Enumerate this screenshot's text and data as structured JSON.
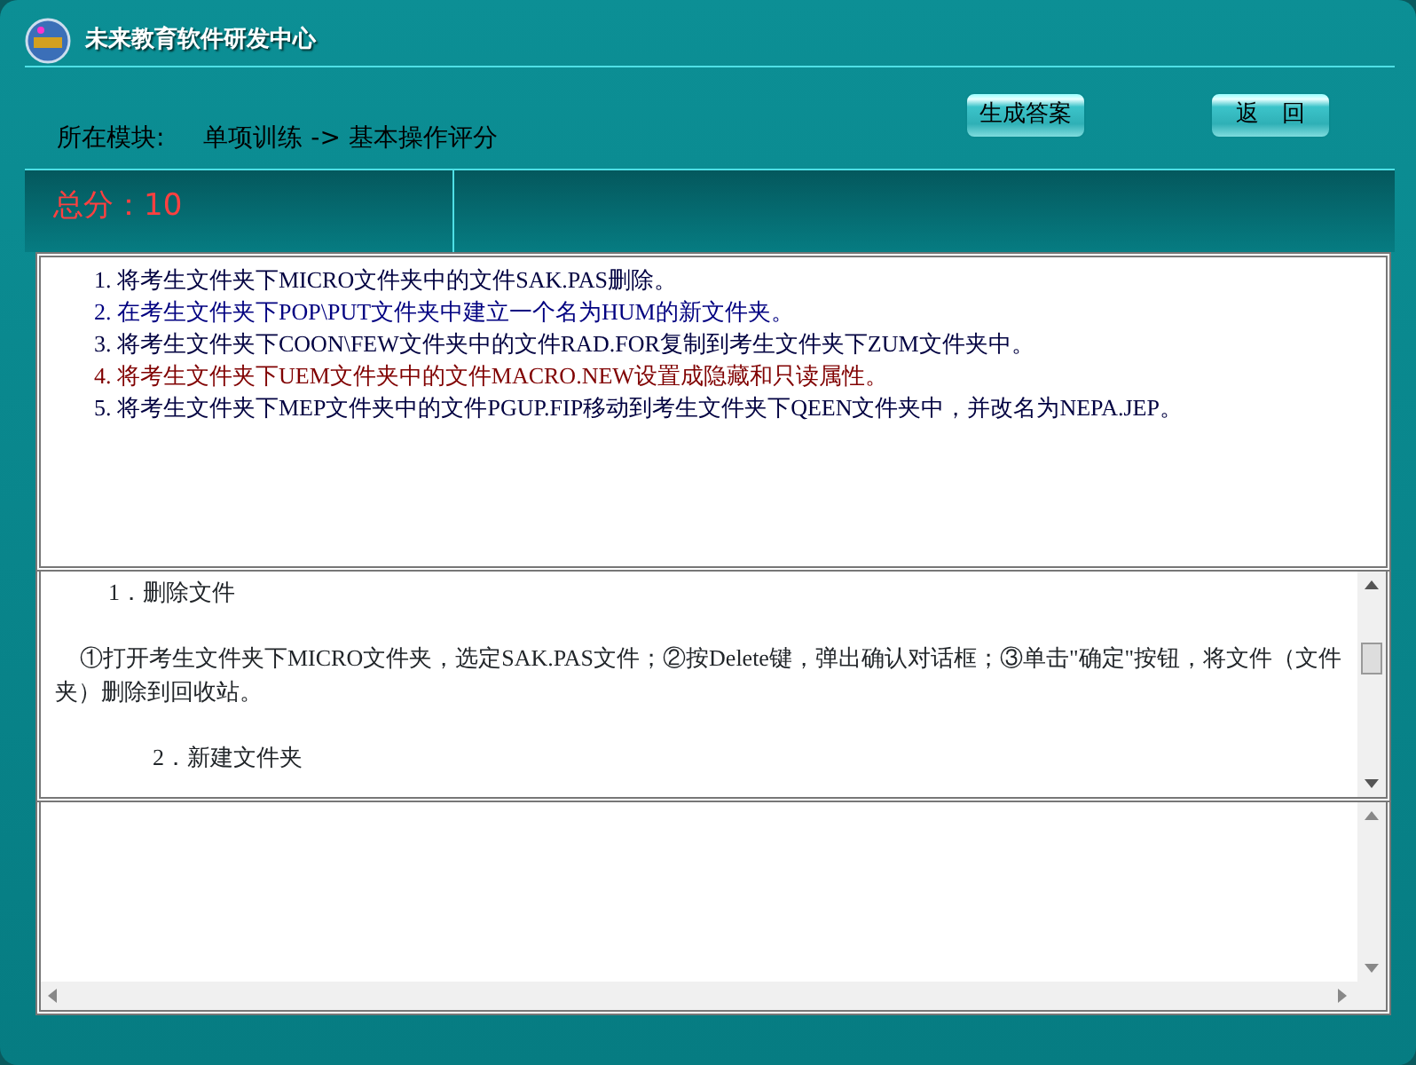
{
  "window": {
    "title": "未来教育软件研发中心"
  },
  "header": {
    "module_label": "所在模块:",
    "module_path": "单项训练 -> 基本操作评分"
  },
  "buttons": [
    {
      "label": "生成答案"
    },
    {
      "label": "返　回"
    }
  ],
  "score": {
    "text": "总分：10"
  },
  "tasks": [
    {
      "text": "1. 将考生文件夹下MICRO文件夹中的文件SAK.PAS删除。",
      "color": "#000040"
    },
    {
      "text": "2. 在考生文件夹下POP\\PUT文件夹中建立一个名为HUM的新文件夹。",
      "color": "#000080"
    },
    {
      "text": "3. 将考生文件夹下COON\\FEW文件夹中的文件RAD.FOR复制到考生文件夹下ZUM文件夹中。",
      "color": "#000040"
    },
    {
      "text": "4. 将考生文件夹下UEM文件夹中的文件MACRO.NEW设置成隐藏和只读属性。",
      "color": "#800000"
    },
    {
      "text": "5. 将考生文件夹下MEP文件夹中的文件PGUP.FIP移动到考生文件夹下QEEN文件夹中，并改名为NEPA.JEP。",
      "color": "#000040"
    }
  ],
  "answer": [
    {
      "kind": "heading",
      "text": "1．删除文件"
    },
    {
      "kind": "paragraph",
      "text": "①打开考生文件夹下MICRO文件夹，选定SAK.PAS文件；②按Delete键，弹出确认对话框；③单击\"确定\"按钮，将文件（文件夹）删除到回收站。"
    },
    {
      "kind": "heading",
      "text": "2．新建文件夹"
    }
  ]
}
